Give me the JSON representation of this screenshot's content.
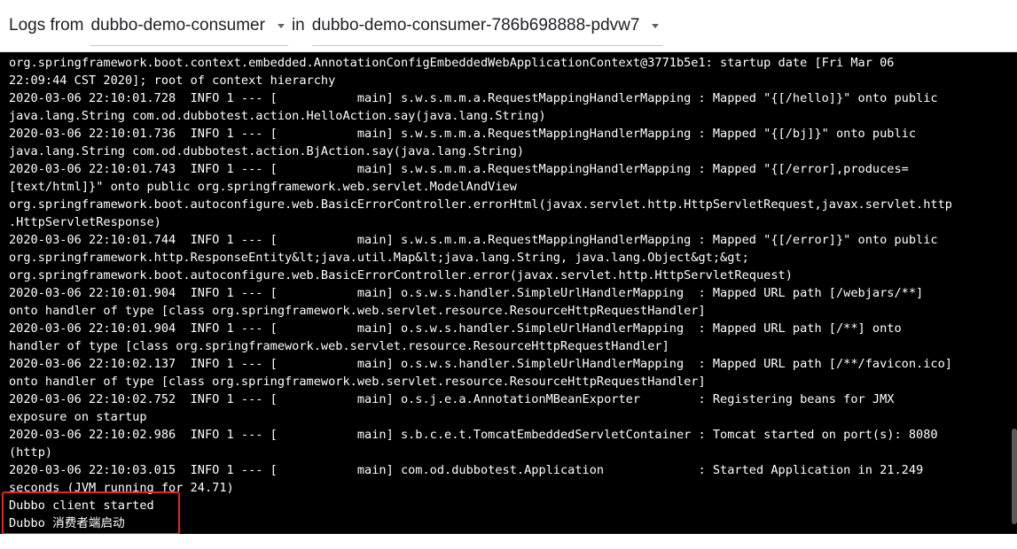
{
  "header": {
    "prefix": "Logs from",
    "container": "dubbo-demo-consumer",
    "in_label": "in",
    "pod": "dubbo-demo-consumer-786b698888-pdvw7"
  },
  "log_lines": [
    "org.springframework.boot.context.embedded.AnnotationConfigEmbeddedWebApplicationContext@3771b5e1: startup date [Fri Mar 06",
    "22:09:44 CST 2020]; root of context hierarchy",
    "2020-03-06 22:10:01.728  INFO 1 --- [           main] s.w.s.m.m.a.RequestMappingHandlerMapping : Mapped \"{[/hello]}\" onto public",
    "java.lang.String com.od.dubbotest.action.HelloAction.say(java.lang.String)",
    "2020-03-06 22:10:01.736  INFO 1 --- [           main] s.w.s.m.m.a.RequestMappingHandlerMapping : Mapped \"{[/bj]}\" onto public",
    "java.lang.String com.od.dubbotest.action.BjAction.say(java.lang.String)",
    "2020-03-06 22:10:01.743  INFO 1 --- [           main] s.w.s.m.m.a.RequestMappingHandlerMapping : Mapped \"{[/error],produces=",
    "[text/html]}\" onto public org.springframework.web.servlet.ModelAndView",
    "org.springframework.boot.autoconfigure.web.BasicErrorController.errorHtml(javax.servlet.http.HttpServletRequest,javax.servlet.http",
    ".HttpServletResponse)",
    "2020-03-06 22:10:01.744  INFO 1 --- [           main] s.w.s.m.m.a.RequestMappingHandlerMapping : Mapped \"{[/error]}\" onto public",
    "org.springframework.http.ResponseEntity&lt;java.util.Map&lt;java.lang.String, java.lang.Object&gt;&gt;",
    "org.springframework.boot.autoconfigure.web.BasicErrorController.error(javax.servlet.http.HttpServletRequest)",
    "2020-03-06 22:10:01.904  INFO 1 --- [           main] o.s.w.s.handler.SimpleUrlHandlerMapping  : Mapped URL path [/webjars/**]",
    "onto handler of type [class org.springframework.web.servlet.resource.ResourceHttpRequestHandler]",
    "2020-03-06 22:10:01.904  INFO 1 --- [           main] o.s.w.s.handler.SimpleUrlHandlerMapping  : Mapped URL path [/**] onto",
    "handler of type [class org.springframework.web.servlet.resource.ResourceHttpRequestHandler]",
    "2020-03-06 22:10:02.137  INFO 1 --- [           main] o.s.w.s.handler.SimpleUrlHandlerMapping  : Mapped URL path [/**/favicon.ico]",
    "onto handler of type [class org.springframework.web.servlet.resource.ResourceHttpRequestHandler]",
    "2020-03-06 22:10:02.752  INFO 1 --- [           main] o.s.j.e.a.AnnotationMBeanExporter        : Registering beans for JMX",
    "exposure on startup",
    "2020-03-06 22:10:02.986  INFO 1 --- [           main] s.b.c.e.t.TomcatEmbeddedServletContainer : Tomcat started on port(s): 8080",
    "(http)",
    "2020-03-06 22:10:03.015  INFO 1 --- [           main] com.od.dubbotest.Application             : Started Application in 21.249",
    "seconds (JVM running for 24.71)",
    "Dubbo client started",
    "Dubbo 消费者端启动"
  ],
  "colors": {
    "log_background": "#000000",
    "log_text": "#ffffff",
    "highlight_border": "#e8241f"
  }
}
